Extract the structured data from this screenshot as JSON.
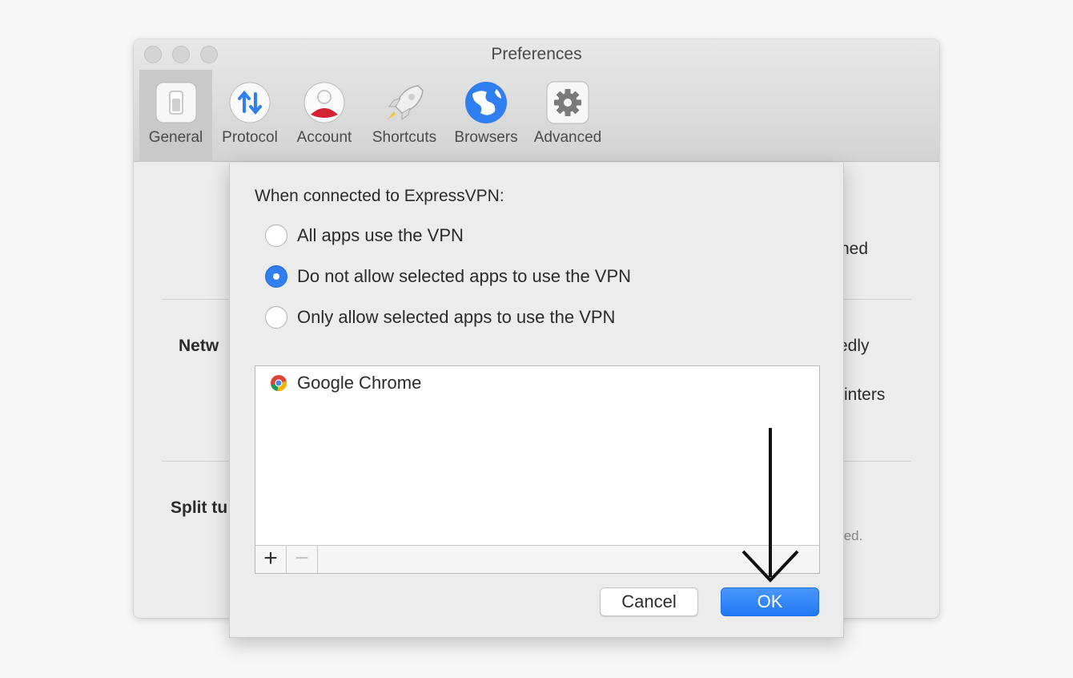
{
  "window": {
    "title": "Preferences"
  },
  "tabs": [
    {
      "label": "General",
      "icon": "switch-icon",
      "selected": true
    },
    {
      "label": "Protocol",
      "icon": "arrows-updown-icon",
      "selected": false
    },
    {
      "label": "Account",
      "icon": "user-icon",
      "selected": false
    },
    {
      "label": "Shortcuts",
      "icon": "rocket-icon",
      "selected": false
    },
    {
      "label": "Browsers",
      "icon": "globe-icon",
      "selected": false
    },
    {
      "label": "Advanced",
      "icon": "gear-icon",
      "selected": false
    }
  ],
  "background": {
    "text_1": "hed",
    "network_label": "Netw",
    "text_2": "edly",
    "text_3": "rinters",
    "split_label": "Split tu",
    "text_4": "ted."
  },
  "sheet": {
    "heading": "When connected to ExpressVPN:",
    "options": [
      {
        "label": "All apps use the VPN",
        "checked": false
      },
      {
        "label": "Do not allow selected apps to use the VPN",
        "checked": true
      },
      {
        "label": "Only allow selected apps to use the VPN",
        "checked": false
      }
    ],
    "apps": [
      {
        "name": "Google Chrome",
        "icon": "chrome-icon"
      }
    ],
    "add_label": "+",
    "remove_label": "−",
    "cancel_label": "Cancel",
    "ok_label": "OK"
  },
  "colors": {
    "accent": "#2f7ff0",
    "ok_button": "#2178f5"
  },
  "annotation": {
    "icon": "arrow-down-icon"
  }
}
